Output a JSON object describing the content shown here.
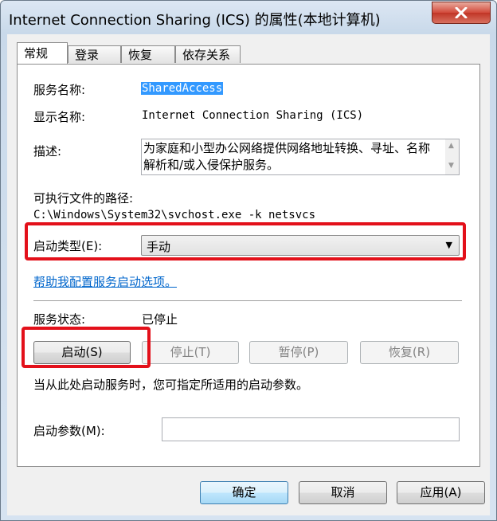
{
  "window": {
    "title": "Internet Connection Sharing (ICS) 的属性(本地计算机)",
    "close_icon": "close-icon"
  },
  "tabs": [
    {
      "label": "常规",
      "active": true
    },
    {
      "label": "登录",
      "active": false
    },
    {
      "label": "恢复",
      "active": false
    },
    {
      "label": "依存关系",
      "active": false
    }
  ],
  "general": {
    "service_name_label": "服务名称:",
    "service_name_value": "SharedAccess",
    "display_name_label": "显示名称:",
    "display_name_value": "Internet Connection Sharing (ICS)",
    "description_label": "描述:",
    "description_value": "为家庭和小型办公网络提供网络地址转换、寻址、名称解析和/或入侵保护服务。",
    "path_label": "可执行文件的路径:",
    "path_value": "C:\\Windows\\System32\\svchost.exe -k netsvcs",
    "startup_type_label": "启动类型(E):",
    "startup_type_value": "手动",
    "help_link": "帮助我配置服务启动选项。",
    "status_label": "服务状态:",
    "status_value": "已停止",
    "buttons": {
      "start": "启动(S)",
      "stop": "停止(T)",
      "pause": "暂停(P)",
      "resume": "恢复(R)"
    },
    "hint": "当从此处启动服务时，您可指定所适用的启动参数。",
    "params_label": "启动参数(M):",
    "params_value": ""
  },
  "footer": {
    "ok": "确定",
    "cancel": "取消",
    "apply": "应用(A)"
  },
  "colors": {
    "highlight_box": "#e3101a",
    "selection": "#3399ff",
    "link": "#0066cc"
  }
}
